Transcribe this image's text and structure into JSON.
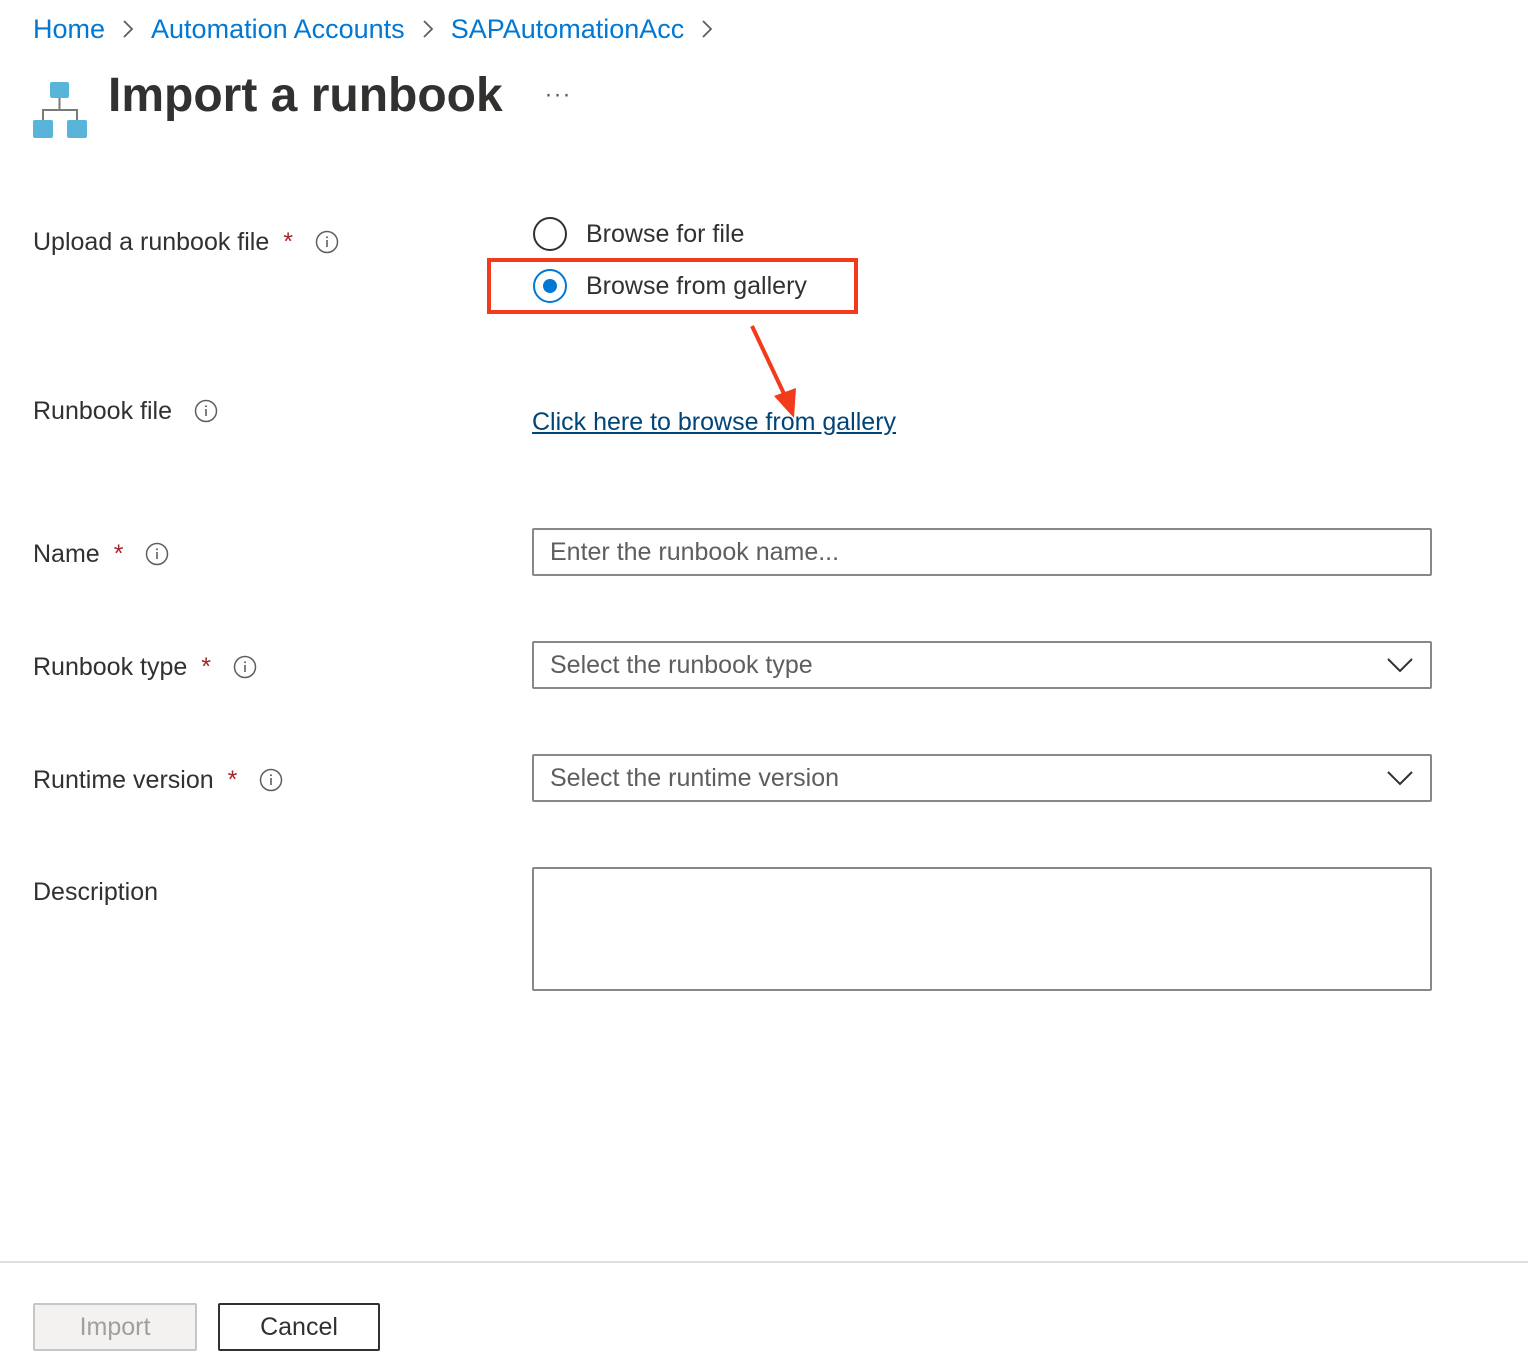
{
  "breadcrumb": {
    "items": [
      "Home",
      "Automation Accounts",
      "SAPAutomationAcc"
    ]
  },
  "header": {
    "title": "Import a runbook",
    "more": "···",
    "icon": "runbook-hierarchy-icon"
  },
  "form": {
    "upload": {
      "label": "Upload a runbook file",
      "required": "*",
      "options": [
        {
          "label": "Browse for file",
          "checked": false
        },
        {
          "label": "Browse from gallery",
          "checked": true
        }
      ]
    },
    "runbook_file": {
      "label": "Runbook file",
      "link": "Click here to browse from gallery"
    },
    "name": {
      "label": "Name",
      "required": "*",
      "value": "",
      "placeholder": "Enter the runbook name..."
    },
    "runbook_type": {
      "label": "Runbook type",
      "required": "*",
      "placeholder": "Select the runbook type"
    },
    "runtime_version": {
      "label": "Runtime version",
      "required": "*",
      "placeholder": "Select the runtime version"
    },
    "description": {
      "label": "Description",
      "value": ""
    }
  },
  "footer": {
    "import_label": "Import",
    "cancel_label": "Cancel"
  },
  "colors": {
    "accent": "#0078d4",
    "link": "#004578",
    "required": "#a4262c",
    "annotation": "#f23a1d"
  }
}
